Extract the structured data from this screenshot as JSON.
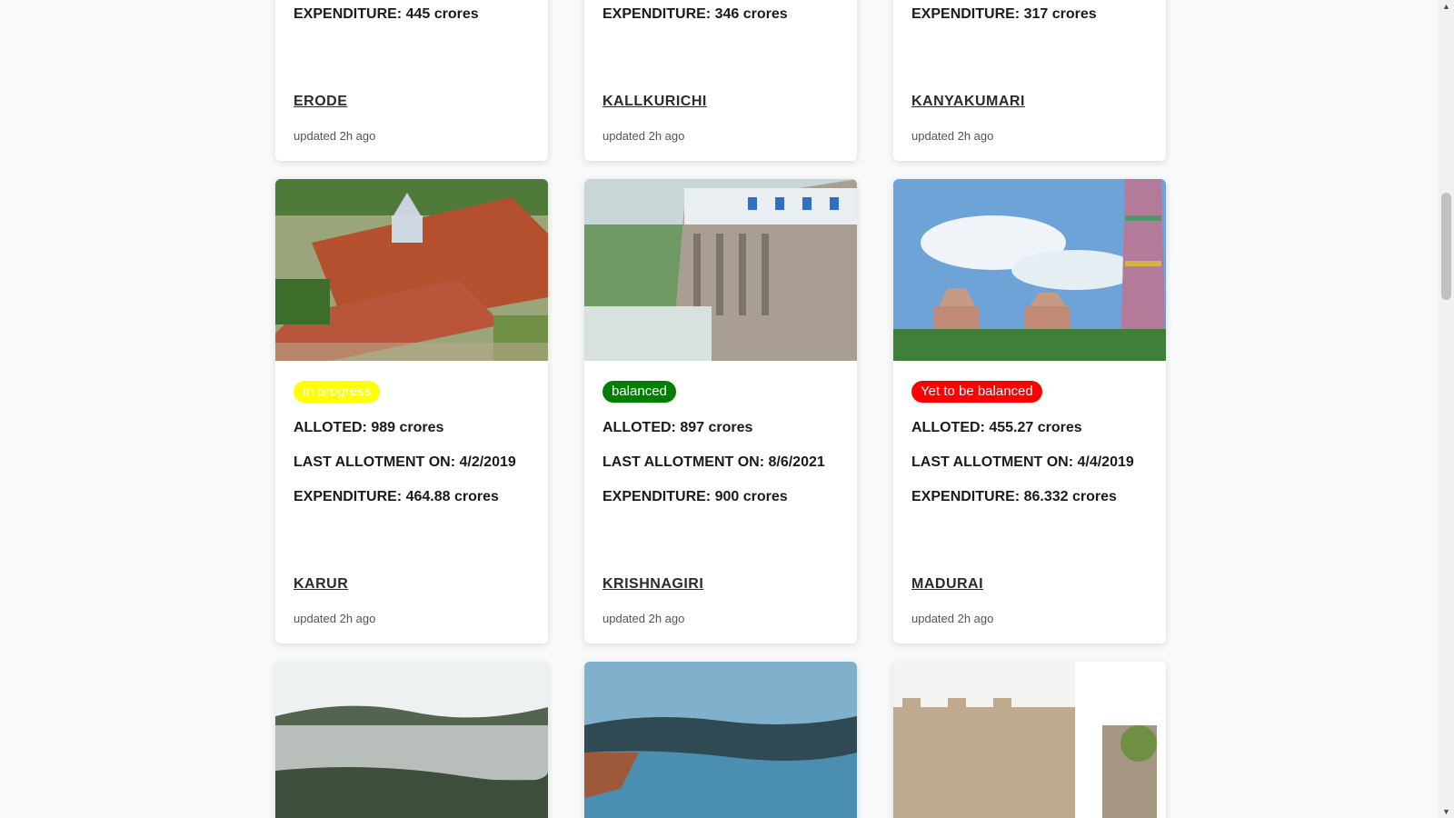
{
  "cards_top": [
    {
      "expenditure": "EXPENDITURE: 445 crores",
      "district": "ERODE",
      "updated": "updated 2h ago"
    },
    {
      "expenditure": "EXPENDITURE: 346 crores",
      "district": "KALLKURICHI",
      "updated": "updated 2h ago"
    },
    {
      "expenditure": "EXPENDITURE: 317 crores",
      "district": "KANYAKUMARI",
      "updated": "updated 2h ago"
    }
  ],
  "cards_middle": [
    {
      "status": "In progress",
      "alloted": "ALLOTED: 989 crores",
      "last_allotment": "LAST ALLOTMENT ON: 4/2/2019",
      "expenditure": "EXPENDITURE: 464.88 crores",
      "district": "KARUR",
      "updated": "updated 2h ago"
    },
    {
      "status": "balanced",
      "alloted": "ALLOTED: 897 crores",
      "last_allotment": "LAST ALLOTMENT ON: 8/6/2021",
      "expenditure": "EXPENDITURE: 900 crores",
      "district": "KRISHNAGIRI",
      "updated": "updated 2h ago"
    },
    {
      "status": "Yet to be balanced",
      "alloted": "ALLOTED: 455.27 crores",
      "last_allotment": "LAST ALLOTMENT ON: 4/4/2019",
      "expenditure": "EXPENDITURE: 86.332 crores",
      "district": "MADURAI",
      "updated": "updated 2h ago"
    }
  ],
  "colors": {
    "in_progress": "#ffff00",
    "balanced": "#008000",
    "yet_to_be_balanced": "#ff0000"
  },
  "scrollbar": {
    "up_icon": "chevron-up-icon",
    "down_icon": "chevron-down-icon"
  }
}
